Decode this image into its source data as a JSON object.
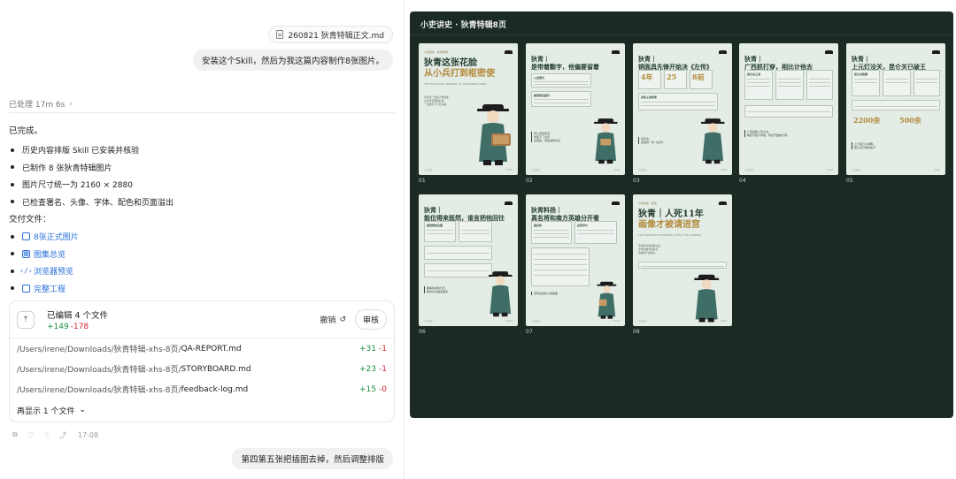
{
  "chat": {
    "attached_file": "260821 狄青特辑正文.md",
    "user_message": "安装这个Skill，然后为我这篇内容制作8张图片。",
    "processed": "已处理 17m 6s",
    "done_label": "已完成。",
    "bullets": [
      "历史内容排版 Skill 已安装并核验",
      "已制作 8 张狄青特辑图片",
      "图片尺寸统一为 2160 × 2880",
      "已检查署名、头像、字体、配色和页面溢出"
    ],
    "deliver_label": "交付文件：",
    "links": [
      {
        "label": "8张正式图片",
        "icon": "file-icon"
      },
      {
        "label": "图集总览",
        "icon": "gallery-icon"
      },
      {
        "label": "浏览器预览",
        "icon": "code-icon"
      },
      {
        "label": "完整工程",
        "icon": "file-icon"
      }
    ],
    "edits": {
      "title": "已编辑 4 个文件",
      "added": "+149",
      "removed": "-178",
      "undo": "撤销",
      "review": "审核",
      "files": [
        {
          "dir": "/Users/irene/Downloads/狄青特辑-xhs-8页/",
          "name": "QA-REPORT.md",
          "added": "+31",
          "removed": "-1"
        },
        {
          "dir": "/Users/irene/Downloads/狄青特辑-xhs-8页/",
          "name": "STORYBOARD.md",
          "added": "+23",
          "removed": "-1"
        },
        {
          "dir": "/Users/irene/Downloads/狄青特辑-xhs-8页/",
          "name": "feedback-log.md",
          "added": "+15",
          "removed": "-0"
        }
      ],
      "more": "再显示 1 个文件"
    },
    "time": "17:08",
    "user_message_2": "第四第五张把插图去掉，然后调整排版"
  },
  "gallery": {
    "title": "小吏讲史 · 狄青特辑8页",
    "cards": [
      {
        "label": "01",
        "tag": "小吏讲史 · 狄青特辑",
        "title_line1": "狄青这张花脸",
        "title_line2": "从小兵打到枢密使",
        "sub": "THE TATTOOED GENERAL OF NORTHERN SONG",
        "body": "北宋第一位武人枢密使\n从罪隶到西陲名将\n一生被天下人盯着看"
      },
      {
        "label": "02",
        "title": "狄青｜\n是带着黥字，他偏要留着",
        "panel1": "入伍那天",
        "panel2": "枢密使当面问",
        "quote": "宋仁宗的原话\n改变不了出身\n这张脸，就是他的凭证"
      },
      {
        "label": "03",
        "title": "狄青｜\n铜面具先锋开始决《左传》",
        "nums": [
          "4年",
          "25",
          "8前"
        ],
        "panel1": "战场上的狄青",
        "quote": "读兵法，\n读懂的一本《左传》"
      },
      {
        "label": "04",
        "title": "狄青｜\n广西抓打穿，相比计他去",
        "panel1": "昆仑关之战",
        "quote": "广西战报入京之后，\n朝廷开始计算他，他也开始被计算。"
      },
      {
        "label": "05",
        "title": "狄青｜\n上元灯没关，昆仑关已破王",
        "nums": [
          "2200余",
          "500余"
        ],
        "panel1": "昆仑关夜袭",
        "quote": "上元夜灯火通明，\n昆仑关已悄然失守"
      },
      {
        "label": "06",
        "title": "狄青｜\n能位得来既然，谁言把他回往",
        "panel1": "枢密使的位置",
        "quote": "看着狄青的升迁，\n朝中议论越来越多"
      },
      {
        "label": "07",
        "title": "狄青料扬｜\n真名将和南方英雄分开看",
        "panel1": "真名将",
        "panel2": "后世评价",
        "quote": "流传后世的人物画像"
      },
      {
        "label": "08",
        "tag": "小吏讲史 · 结尾",
        "title_line1": "狄青｜人死11年",
        "title_line2": "画像才被请进宫",
        "sub": "THE PORTRAIT RETURNED AFTER THE GENERAL",
        "body": "宋神宗为他画像之后\n这张脸被重新看见\n英雄终于被承认"
      }
    ]
  }
}
